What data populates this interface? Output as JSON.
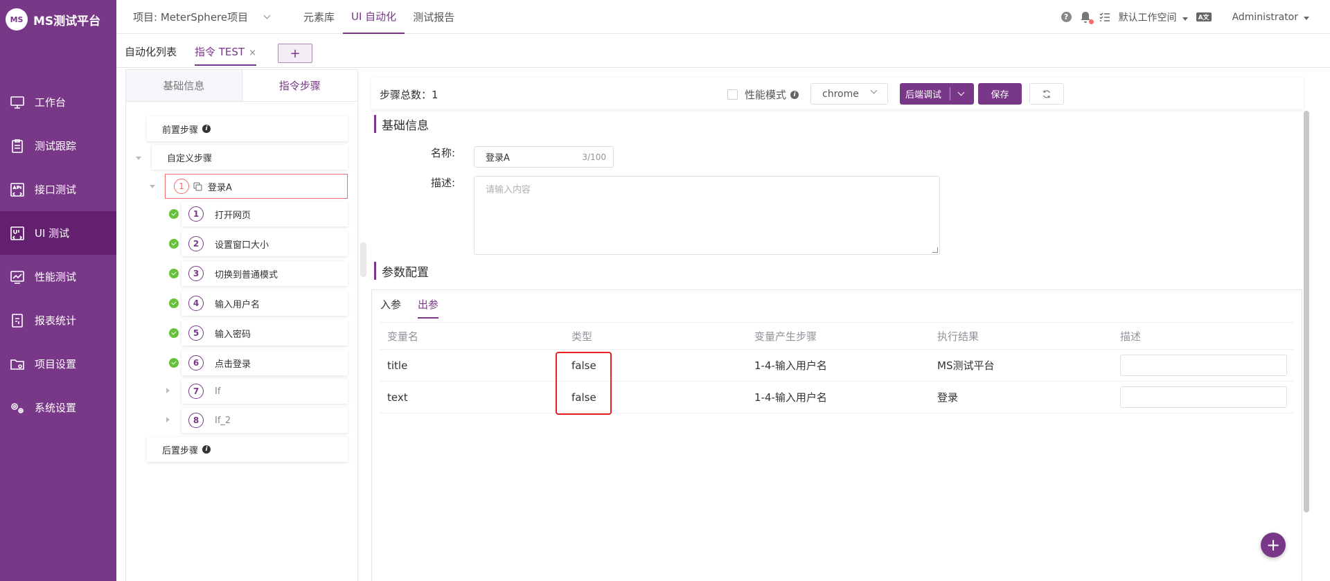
{
  "app": {
    "logo_text": "MS测试平台",
    "logo_badge": "MS"
  },
  "sidebar": {
    "items": [
      {
        "label": "工作台",
        "icon": "monitor-icon"
      },
      {
        "label": "测试跟踪",
        "icon": "clipboard-icon"
      },
      {
        "label": "接口测试",
        "icon": "api-icon"
      },
      {
        "label": "UI 测试",
        "icon": "ui-icon",
        "active": true
      },
      {
        "label": "性能测试",
        "icon": "chart-icon"
      },
      {
        "label": "报表统计",
        "icon": "report-icon"
      },
      {
        "label": "项目设置",
        "icon": "folder-icon"
      },
      {
        "label": "系统设置",
        "icon": "gear-icon"
      }
    ]
  },
  "header": {
    "project": "项目: MeterSphere项目",
    "menu": [
      "元素库",
      "UI 自动化",
      "测试报告"
    ],
    "active_menu": "UI 自动化",
    "workspace": "默认工作空间",
    "lang_badge": "A文",
    "user": "Administrator"
  },
  "subtabs": {
    "list_label": "自动化列表",
    "active_label": "指令 TEST",
    "close": "×",
    "add": "+"
  },
  "left_panel": {
    "tabs": [
      "基础信息",
      "指令步骤"
    ],
    "pre_step": "前置步骤",
    "custom_step": "自定义步骤",
    "login_step": {
      "num": "1",
      "label": "登录A"
    },
    "steps": [
      {
        "num": "1",
        "label": "打开网页"
      },
      {
        "num": "2",
        "label": "设置窗口大小"
      },
      {
        "num": "3",
        "label": "切换到普通模式"
      },
      {
        "num": "4",
        "label": "输入用户名"
      },
      {
        "num": "5",
        "label": "输入密码"
      },
      {
        "num": "6",
        "label": "点击登录"
      }
    ],
    "if_steps": [
      {
        "num": "7",
        "label": "If"
      },
      {
        "num": "8",
        "label": "If_2"
      }
    ],
    "post_step": "后置步骤"
  },
  "toolbar": {
    "step_total": "步骤总数：1",
    "perf_mode": "性能模式",
    "browser": "chrome",
    "debug": "后端调试",
    "save": "保存"
  },
  "basic_info": {
    "title": "基础信息",
    "name_label": "名称:",
    "name_value": "登录A",
    "name_count": "3/100",
    "desc_label": "描述:",
    "desc_placeholder": "请输入内容"
  },
  "params": {
    "title": "参数配置",
    "tabs": [
      "入参",
      "出参"
    ],
    "active_tab": "出参",
    "columns": [
      "变量名",
      "类型",
      "变量产生步骤",
      "执行结果",
      "描述"
    ],
    "rows": [
      {
        "name": "title",
        "type": "false",
        "step": "1-4-输入用户名",
        "result": "MS测试平台"
      },
      {
        "name": "text",
        "type": "false",
        "step": "1-4-输入用户名",
        "result": "登录"
      }
    ]
  },
  "colors": {
    "brand": "#783887",
    "success": "#67c23a",
    "danger": "#f56c6c",
    "highlight": "#e82020"
  }
}
